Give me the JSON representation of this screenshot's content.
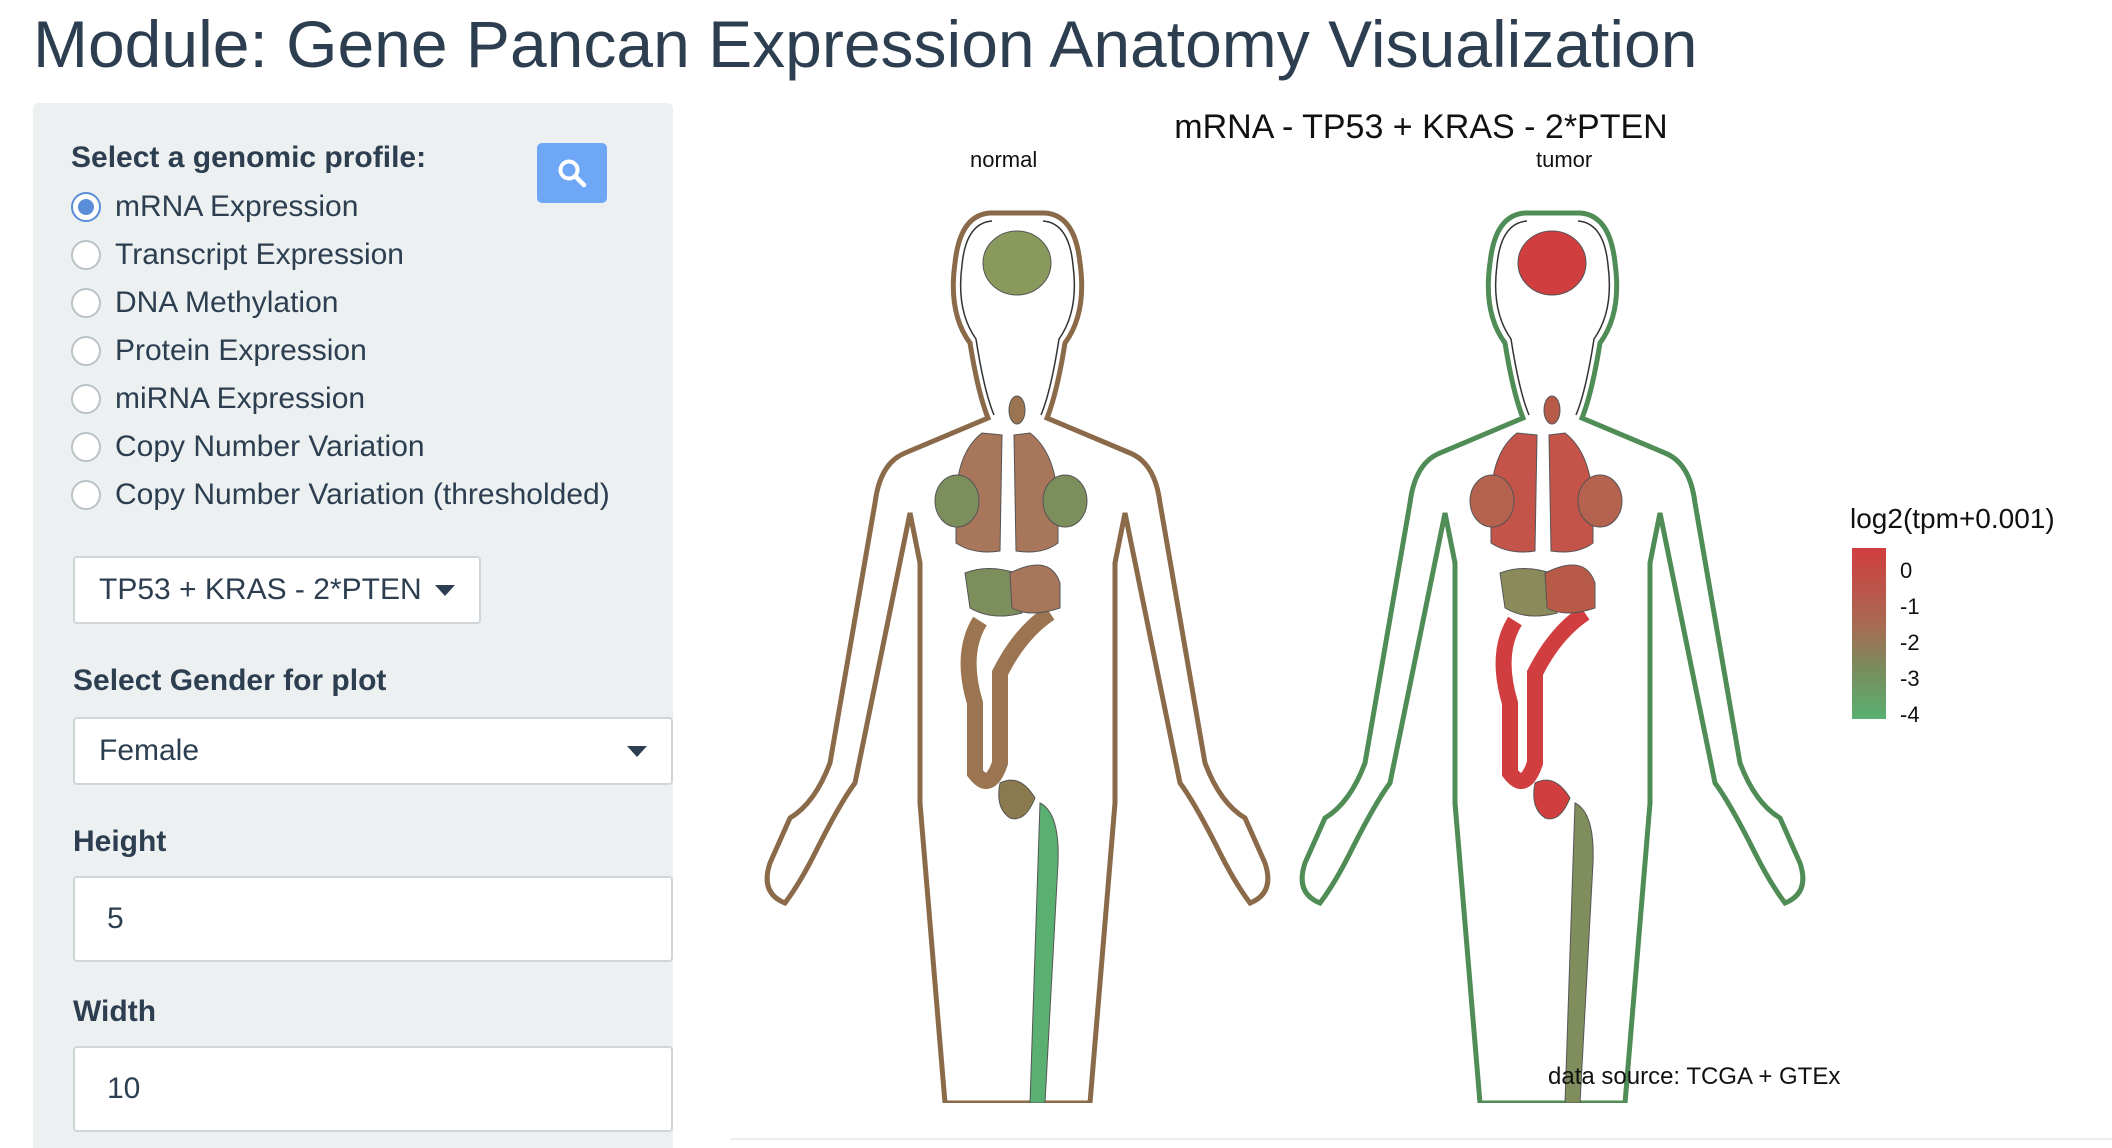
{
  "page": {
    "title": "Module: Gene Pancan Expression Anatomy Visualization"
  },
  "sidebar": {
    "profile_label": "Select a genomic profile:",
    "profiles": [
      {
        "label": "mRNA Expression",
        "checked": true
      },
      {
        "label": "Transcript Expression",
        "checked": false
      },
      {
        "label": "DNA Methylation",
        "checked": false
      },
      {
        "label": "Protein Expression",
        "checked": false
      },
      {
        "label": "miRNA Expression",
        "checked": false
      },
      {
        "label": "Copy Number Variation",
        "checked": false
      },
      {
        "label": "Copy Number Variation (thresholded)",
        "checked": false
      }
    ],
    "gene_select": {
      "value": "TP53 + KRAS - 2*PTEN"
    },
    "gender_label": "Select Gender for plot",
    "gender_select": {
      "value": "Female"
    },
    "height_label": "Height",
    "height_value": "5",
    "width_label": "Width",
    "width_value": "10"
  },
  "plot": {
    "title": "mRNA - TP53 + KRAS - 2*PTEN",
    "panels": [
      "normal",
      "tumor"
    ],
    "legend_title": "log2(tpm+0.001)",
    "legend_ticks": [
      "0",
      "-1",
      "-2",
      "-3",
      "-4"
    ],
    "source": "data source: TCGA + GTEx",
    "colors": {
      "high": "#d13e3f",
      "mid": "#a86a52",
      "low": "#5ab071"
    }
  }
}
